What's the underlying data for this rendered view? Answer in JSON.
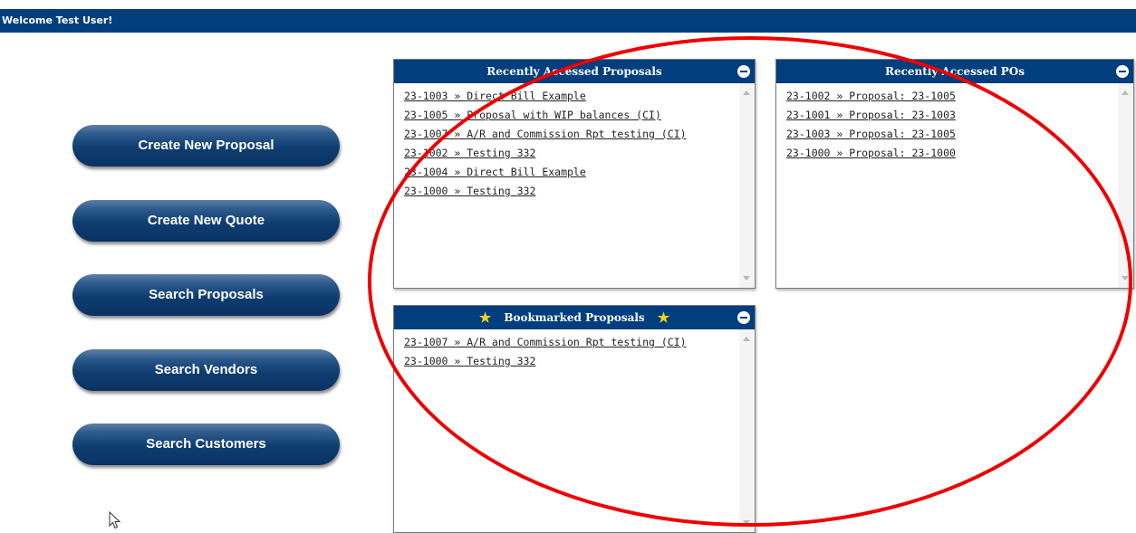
{
  "header": {
    "welcome": "Welcome Test User!"
  },
  "buttons": [
    {
      "label": "Create New Proposal"
    },
    {
      "label": "Create New Quote"
    },
    {
      "label": "Search Proposals"
    },
    {
      "label": "Search Vendors"
    },
    {
      "label": "Search Customers"
    }
  ],
  "recent_proposals": {
    "title": "Recently Accessed Proposals",
    "items": [
      "23-1003 » Direct Bill Example",
      "23-1005 » Proposal with WIP balances (CI)",
      "23-1007 » A/R and Commission Rpt testing (CI)",
      "23-1002 » Testing 332",
      "23-1004 » Direct Bill Example",
      "23-1000 » Testing 332"
    ]
  },
  "recent_pos": {
    "title": "Recently Accessed POs",
    "items": [
      "23-1002 » Proposal: 23-1005",
      "23-1001 » Proposal: 23-1003",
      "23-1003 » Proposal: 23-1005",
      "23-1000 » Proposal: 23-1000"
    ]
  },
  "bookmarked": {
    "title": "Bookmarked Proposals",
    "items": [
      "23-1007 » A/R and Commission Rpt testing (CI)",
      "23-1000 » Testing 332"
    ]
  },
  "colors": {
    "brand": "#003e7e",
    "highlight_circle": "#ee0000",
    "star": "#f2d21e"
  },
  "icons": {
    "collapse": "minus-circle-icon",
    "star": "star-icon",
    "cursor": "arrow-cursor-icon"
  }
}
